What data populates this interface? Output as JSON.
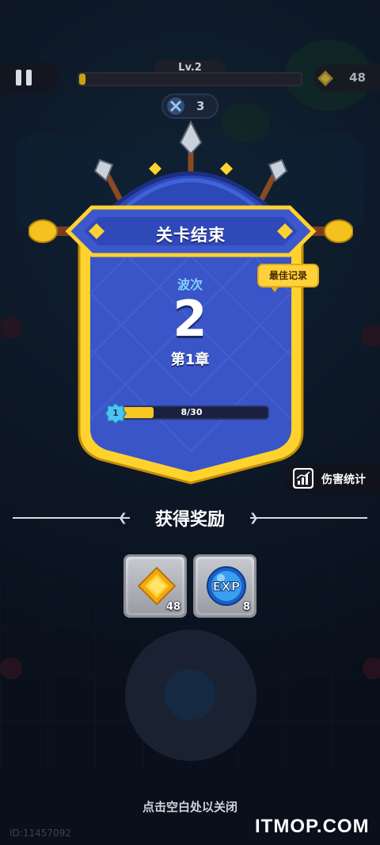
{
  "hud": {
    "level": "Lv.2",
    "level_progress": 0.0,
    "gold": "48",
    "kills": "3"
  },
  "result": {
    "title": "关卡结束",
    "best_record": "最佳记录",
    "wave_label": "波次",
    "wave_value": "2",
    "chapter": "第1章",
    "progress_level": "1",
    "progress_text": "8/30",
    "progress_fraction": 0.267
  },
  "damage_stats_label": "伤害统计",
  "rewards": {
    "title": "获得奖励",
    "items": [
      {
        "icon": "gold-coin-icon",
        "count": "48"
      },
      {
        "icon": "exp-orb-icon",
        "label": "EXP",
        "count": "8"
      }
    ]
  },
  "close_hint": "点击空白处以关闭",
  "uid": "ID:11457092",
  "watermark": "ITMOP.COM",
  "colors": {
    "shield_blue": "#3a55c7",
    "shield_gold": "#ffd22e",
    "accent_yellow": "#f7c621",
    "wave_label": "#7fd3ff"
  }
}
